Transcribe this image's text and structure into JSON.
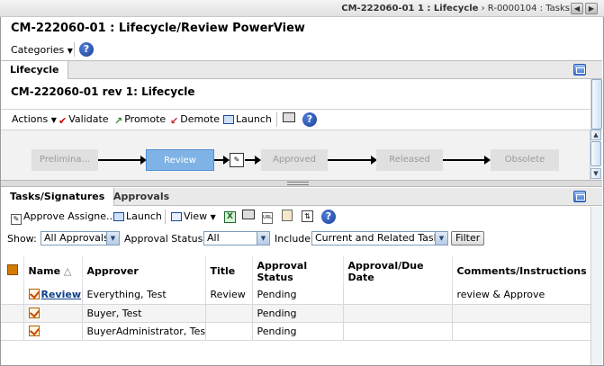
{
  "breadcrumb": {
    "bold": "CM-222060-01 1 : Lifecycle",
    "rest": " › R-0000104 : Tasks"
  },
  "header": {
    "title": "CM-222060-01 : Lifecycle/Review PowerView",
    "categories_label": "Categories"
  },
  "lifecycle_panel": {
    "tab": "Lifecycle",
    "title": "CM-222060-01 rev 1: Lifecycle",
    "actions": {
      "actions": "Actions",
      "validate": "Validate",
      "promote": "Promote",
      "demote": "Demote",
      "launch": "Launch"
    },
    "stages": [
      "Prelimina...",
      "Review",
      "Approved",
      "Released",
      "Obsolete"
    ],
    "current_stage": "Review"
  },
  "tasks_panel": {
    "tabs": [
      "Tasks/Signatures",
      "Approvals"
    ],
    "toolbar": {
      "approve": "Approve Assigne...",
      "launch": "Launch",
      "view": "View"
    },
    "filters": {
      "show_label": "Show:",
      "show_value": "All Approvals",
      "status_label": "Approval Status:",
      "status_value": "All",
      "include_label": "Include:",
      "include_value": "Current and Related Tasks",
      "filter_button": "Filter"
    },
    "columns": [
      "Name",
      "Approver",
      "Title",
      "Approval Status",
      "Approval/Due Date",
      "Comments/Instructions"
    ],
    "rows": [
      {
        "name": "Review",
        "approver": "Everything, Test",
        "title": "Review",
        "status": "Pending",
        "due": "",
        "comments": "review & Approve"
      },
      {
        "name": "",
        "approver": "Buyer, Test",
        "title": "",
        "status": "Pending",
        "due": "",
        "comments": ""
      },
      {
        "name": "",
        "approver": "BuyerAdministrator, Test",
        "title": "",
        "status": "Pending",
        "due": "",
        "comments": ""
      }
    ]
  },
  "colors": {
    "current_stage": "#7fb3e6",
    "link": "#0e3f8a",
    "accent": "#3f77d6"
  }
}
